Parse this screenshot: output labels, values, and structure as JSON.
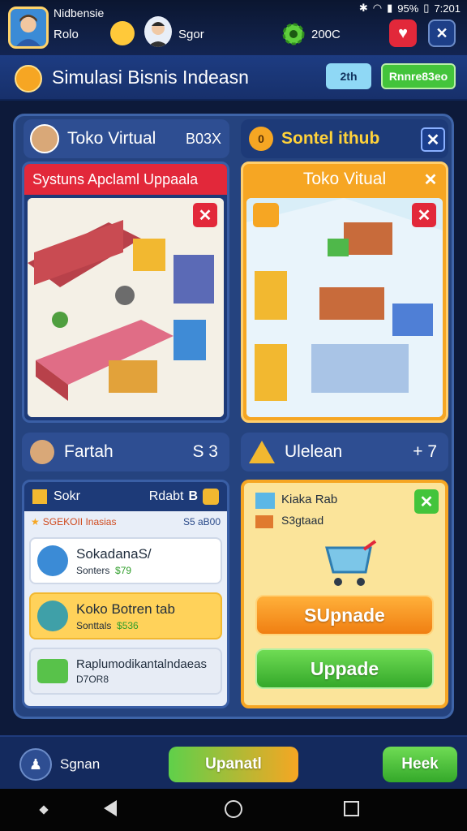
{
  "status_bar": {
    "bluetooth_icon": "bluetooth-icon",
    "wifi_icon": "wifi-icon",
    "signal_icon": "signal-icon",
    "battery": "95%",
    "time": "7:201"
  },
  "hud": {
    "player_name": "Nidbensie",
    "player_sub": "Rolo",
    "friend_count": "Sgor",
    "coins": "200C"
  },
  "title_bar": {
    "title": "Simulasi Bisnis Indeasn",
    "counter_label": "2th",
    "action_label": "Rnnre83eo"
  },
  "left_panel": {
    "tab_title": "Toko Virtual",
    "tab_badge": "B03X",
    "banner_title": "Systuns Apclaml Uppaala"
  },
  "right_panel": {
    "tab_title": "Sontel ithub",
    "tab_badge": "0",
    "header_title": "Toko Vitual"
  },
  "stats": {
    "left_label": "Fartah",
    "left_value": "S 3",
    "right_label": "Ulelean",
    "right_value": "+ 7"
  },
  "shop_list": {
    "title": "Sokr",
    "title_right": "Rdabt",
    "title_count": "B",
    "sub_left": "SGEKOII Inasias",
    "sub_right": "S5 aB00",
    "items": [
      {
        "name": "SokadanaS/",
        "sub": "Sonters",
        "price": "$79",
        "bg": "#ffffff"
      },
      {
        "name": "Koko Botren tab",
        "sub": "Sonttals",
        "price": "$536",
        "bg": "#ffd25a"
      },
      {
        "name": "Raplumodikantalndaeas",
        "sub": "D7OR8",
        "price": "",
        "bg": "#e7ecf5"
      }
    ]
  },
  "upgrade_panel": {
    "line1": "Kiaka Rab",
    "line2": "S3gtaad",
    "btn_orange": "SUpnade",
    "btn_green": "Uppade"
  },
  "action_bar": {
    "user_label": "Sgnan",
    "center_btn": "Upanatl",
    "right_btn": "Heek"
  },
  "colors": {
    "accent_orange": "#f6951e",
    "accent_green": "#43c43b",
    "danger_red": "#e2283a",
    "panel_blue": "#25437f"
  }
}
